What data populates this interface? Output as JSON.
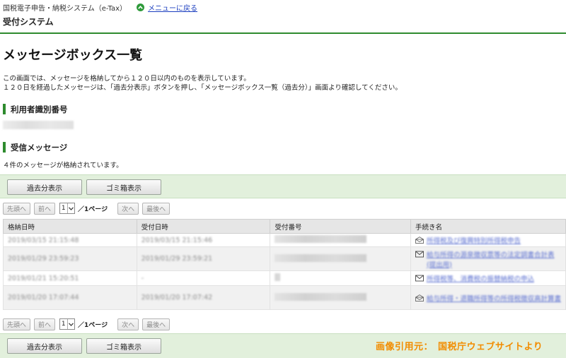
{
  "header": {
    "system_name": "国税電子申告・納税システム（e-Tax）",
    "back_link": "メニューに戻る",
    "sub_system": "受付システム"
  },
  "page": {
    "title": "メッセージボックス一覧",
    "desc_line1": "この画面では、メッセージを格納してから１２０日以内のものを表示しています。",
    "desc_line2": "１２０日を経過したメッセージは、「過去分表示」ボタンを押し、「メッセージボックス一覧（過去分）」画面より確認してください。"
  },
  "sections": {
    "user_id": "利用者識別番号",
    "inbox": "受信メッセージ",
    "count_text": "４件のメッセージが格納されています。"
  },
  "buttons": {
    "past": "過去分表示",
    "trash": "ゴミ箱表示"
  },
  "pager": {
    "first": "先頭へ",
    "prev": "前へ",
    "page_value": "1",
    "page_info": "／1ページ",
    "next": "次へ",
    "last": "最後へ"
  },
  "table": {
    "headers": [
      "格納日時",
      "受付日時",
      "受付番号",
      "手続き名"
    ],
    "rows": [
      {
        "stored": "2019/03/15 21:15:48",
        "received": "2019/03/15 21:15:46",
        "icon": "open-envelope-icon",
        "proc": "所得税及び復興特別所得税申告"
      },
      {
        "stored": "2019/01/29 23:59:23",
        "received": "2019/01/29 23:59:21",
        "icon": "envelope-icon",
        "proc": "給与所得の源泉徴収票等の法定調書合計表",
        "proc2": "(提出用)"
      },
      {
        "stored": "2019/01/21 15:20:51",
        "received": "-",
        "icon": "envelope-icon",
        "proc": "所得税等、消費税の振替納税の申込"
      },
      {
        "stored": "2019/01/20 17:07:44",
        "received": "2019/01/20 17:07:42",
        "icon": "open-envelope-icon",
        "proc": "給与所得・退職所得等の所得税徴収高計算書"
      }
    ]
  },
  "credit": "画像引用元：　国税庁ウェブサイトより",
  "colors": {
    "accent_green": "#2e8b2e",
    "band": "#e2f0dc",
    "credit": "#f28c00",
    "link": "#1a3dbf"
  }
}
